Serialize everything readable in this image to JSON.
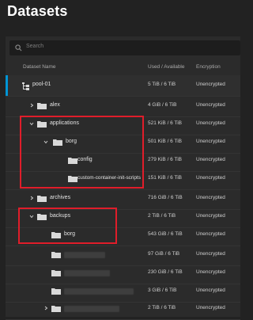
{
  "page": {
    "title": "Datasets"
  },
  "search": {
    "placeholder": "Search"
  },
  "table": {
    "headers": {
      "name": "Dataset Name",
      "used": "Used / Available",
      "encryption": "Encryption"
    },
    "rows": [
      {
        "name": "pool-01",
        "used": "5 TiB / 6 TiB",
        "encryption": "Unencrypted",
        "icon": "pool-tree-icon"
      },
      {
        "name": "alex",
        "used": "4 GiB / 6 TiB",
        "encryption": "Unencrypted",
        "icon": "folder-icon"
      },
      {
        "name": "applications",
        "used": "521 KiB / 6 TiB",
        "encryption": "Unencrypted",
        "icon": "folder-icon"
      },
      {
        "name": "borg",
        "used": "501 KiB / 6 TiB",
        "encryption": "Unencrypted",
        "icon": "folder-icon"
      },
      {
        "name": "config",
        "used": "279 KiB / 6 TiB",
        "encryption": "Unencrypted",
        "icon": "folder-icon"
      },
      {
        "name": "custom-container-init-scripts",
        "used": "151 KiB / 6 TiB",
        "encryption": "Unencrypted",
        "icon": "folder-icon"
      },
      {
        "name": "archives",
        "used": "716 GiB / 6 TiB",
        "encryption": "Unencrypted",
        "icon": "folder-icon"
      },
      {
        "name": "backups",
        "used": "2 TiB / 6 TiB",
        "encryption": "Unencrypted",
        "icon": "folder-icon"
      },
      {
        "name": "borg",
        "used": "543 GiB / 6 TiB",
        "encryption": "Unencrypted",
        "icon": "folder-icon"
      },
      {
        "name": "",
        "used": "97 GiB / 6 TiB",
        "encryption": "Unencrypted",
        "icon": "folder-icon"
      },
      {
        "name": "",
        "used": "230 GiB / 6 TiB",
        "encryption": "Unencrypted",
        "icon": "folder-icon"
      },
      {
        "name": "",
        "used": "3 GiB / 6 TiB",
        "encryption": "Unencrypted",
        "icon": "folder-icon"
      },
      {
        "name": "",
        "used": "2 TiB / 6 TiB",
        "encryption": "Unencrypted",
        "icon": "folder-icon"
      }
    ]
  },
  "colors": {
    "selection_accent": "#0095d5",
    "highlight_box": "#e01d2a",
    "folder": "#d9d9d9"
  }
}
